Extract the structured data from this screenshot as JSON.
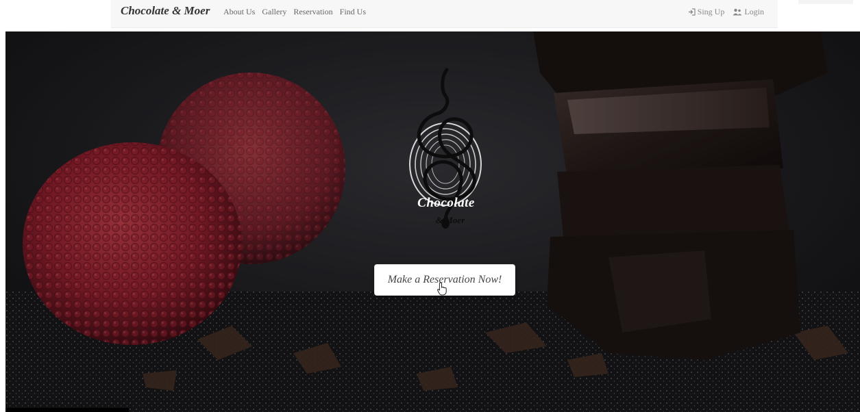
{
  "navbar": {
    "brand": "Chocolate & Moer",
    "links": [
      "About Us",
      "Gallery",
      "Reservation",
      "Find Us"
    ],
    "signup_label": "Sing Up",
    "login_label": "Login"
  },
  "hero": {
    "logo": {
      "line1": "Chocolate",
      "line2": "& Moer"
    },
    "cta_label": "Make a Reservation Now!"
  },
  "icons": {
    "signup": "sign-in-icon",
    "login": "users-icon"
  },
  "colors": {
    "navbar_bg": "#f7f7f7",
    "brand_text": "#333333",
    "nav_link": "#666666",
    "hero_bg": "#1b1a1c",
    "raspberry": "#b3283a",
    "chocolate": "#2a1f1c",
    "cta_bg": "#ffffff"
  }
}
